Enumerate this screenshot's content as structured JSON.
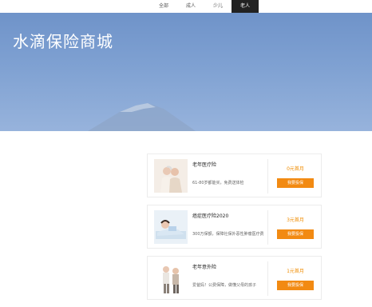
{
  "tabs": [
    {
      "label": "全部",
      "active": false
    },
    {
      "label": "成人",
      "active": false
    },
    {
      "label": "少儿",
      "active": false
    },
    {
      "label": "老人",
      "active": true
    }
  ],
  "hero": {
    "title": "水滴保险商城"
  },
  "products": [
    {
      "name": "老年医疗险",
      "desc": "61-80岁都能买，免费送体检",
      "price": "0元首月",
      "button": "我要投保"
    },
    {
      "name": "癌症医疗险2020",
      "desc": "300万保额，保障社保外恶性肿瘤医疗费",
      "price": "3元首月",
      "button": "我要投保"
    },
    {
      "name": "老年意外险",
      "desc": "爱爸妈！公费保障，做懂父母的孩子",
      "price": "1元首月",
      "button": "我要投保"
    }
  ]
}
